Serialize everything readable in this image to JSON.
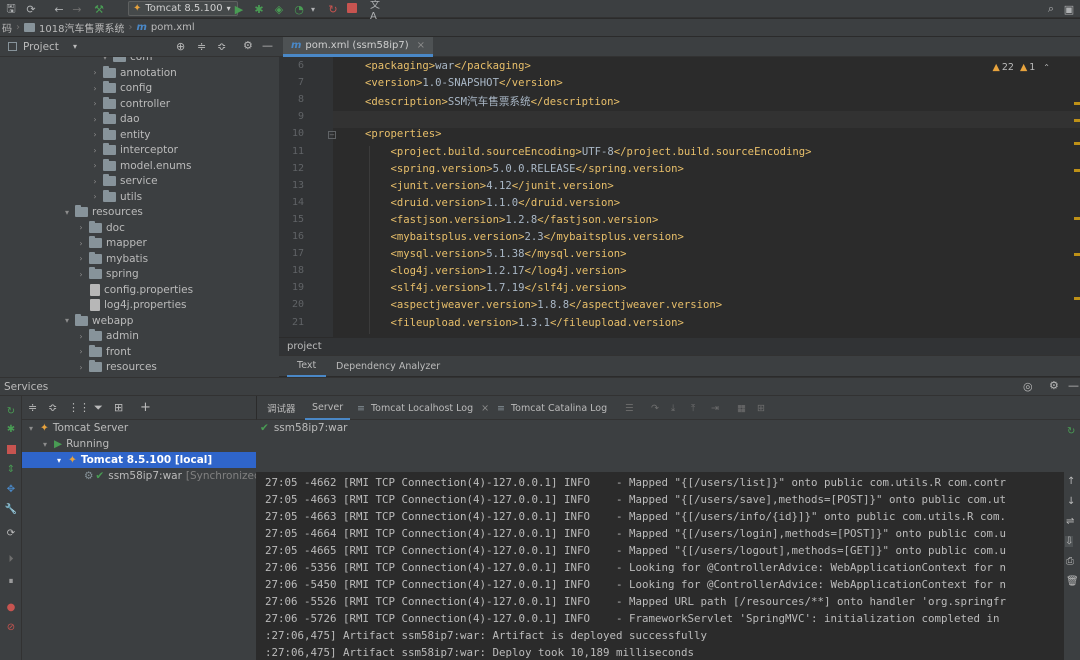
{
  "toolbar": {
    "run_config": "Tomcat 8.5.100",
    "translate_icon": "文A"
  },
  "breadcrumb": {
    "project": "码",
    "module": "1018汽车售票系统",
    "file_glyph": "m",
    "file": "pom.xml"
  },
  "project_panel": {
    "title": "Project",
    "items": [
      {
        "label": "com",
        "kind": "folder",
        "expanded": true
      },
      {
        "label": "annotation",
        "kind": "folder"
      },
      {
        "label": "config",
        "kind": "folder"
      },
      {
        "label": "controller",
        "kind": "folder"
      },
      {
        "label": "dao",
        "kind": "folder"
      },
      {
        "label": "entity",
        "kind": "folder"
      },
      {
        "label": "interceptor",
        "kind": "folder"
      },
      {
        "label": "model.enums",
        "kind": "folder"
      },
      {
        "label": "service",
        "kind": "folder"
      },
      {
        "label": "utils",
        "kind": "folder"
      },
      {
        "label": "resources",
        "kind": "folder",
        "expanded": true
      },
      {
        "label": "doc",
        "kind": "folder"
      },
      {
        "label": "mapper",
        "kind": "folder"
      },
      {
        "label": "mybatis",
        "kind": "folder"
      },
      {
        "label": "spring",
        "kind": "folder"
      },
      {
        "label": "config.properties",
        "kind": "file"
      },
      {
        "label": "log4j.properties",
        "kind": "file"
      },
      {
        "label": "webapp",
        "kind": "folder",
        "expanded": true
      },
      {
        "label": "admin",
        "kind": "folder"
      },
      {
        "label": "front",
        "kind": "folder"
      },
      {
        "label": "resources",
        "kind": "folder"
      }
    ]
  },
  "editor": {
    "tab_glyph": "m",
    "tab_label": "pom.xml (ssm58ip7)",
    "tab_close": "×",
    "warnings": "22",
    "weak_warnings": "1",
    "lines": [
      {
        "no": "6",
        "code": "<packaging>war</packaging>"
      },
      {
        "no": "7",
        "code": "<version>1.0-SNAPSHOT</version>"
      },
      {
        "no": "8",
        "code": "<description>SSM汽车售票系统</description>"
      },
      {
        "no": "9",
        "code": ""
      },
      {
        "no": "10",
        "code": "<properties>"
      },
      {
        "no": "11",
        "code": "    <project.build.sourceEncoding>UTF-8</project.build.sourceEncoding>"
      },
      {
        "no": "12",
        "code": "    <spring.version>5.0.0.RELEASE</spring.version>"
      },
      {
        "no": "13",
        "code": "    <junit.version>4.12</junit.version>"
      },
      {
        "no": "14",
        "code": "    <druid.version>1.1.0</druid.version>"
      },
      {
        "no": "15",
        "code": "    <fastjson.version>1.2.8</fastjson.version>"
      },
      {
        "no": "16",
        "code": "    <mybaitsplus.version>2.3</mybaitsplus.version>"
      },
      {
        "no": "17",
        "code": "    <mysql.version>5.1.38</mysql.version>"
      },
      {
        "no": "18",
        "code": "    <log4j.version>1.2.17</log4j.version>"
      },
      {
        "no": "19",
        "code": "    <slf4j.version>1.7.19</slf4j.version>"
      },
      {
        "no": "20",
        "code": "    <aspectjweaver.version>1.8.8</aspectjweaver.version>"
      },
      {
        "no": "21",
        "code": "    <fileupload.version>1.3.1</fileupload.version>"
      }
    ],
    "footer_breadcrumb": "project",
    "bottom_tabs": [
      "Text",
      "Dependency Analyzer"
    ]
  },
  "services": {
    "title": "Services",
    "tree": {
      "server": "Tomcat Server",
      "status": "Running",
      "instance": "Tomcat 8.5.100 [local]",
      "artifact": "ssm58ip7:war",
      "artifact_state": "[Synchronized]"
    },
    "tabs": [
      "调试器",
      "Server",
      "Tomcat Localhost Log",
      "Tomcat Catalina Log"
    ],
    "deployment": "ssm58ip7:war",
    "log_lines": [
      "27:05 -4662 [RMI TCP Connection(4)-127.0.0.1] INFO    - Mapped \"{[/users/list]}\" onto public com.utils.R com.contr",
      "27:05 -4663 [RMI TCP Connection(4)-127.0.0.1] INFO    - Mapped \"{[/users/save],methods=[POST]}\" onto public com.ut",
      "27:05 -4663 [RMI TCP Connection(4)-127.0.0.1] INFO    - Mapped \"{[/users/info/{id}]}\" onto public com.utils.R com.",
      "27:05 -4664 [RMI TCP Connection(4)-127.0.0.1] INFO    - Mapped \"{[/users/login],methods=[POST]}\" onto public com.u",
      "27:05 -4665 [RMI TCP Connection(4)-127.0.0.1] INFO    - Mapped \"{[/users/logout],methods=[GET]}\" onto public com.u",
      "27:06 -5356 [RMI TCP Connection(4)-127.0.0.1] INFO    - Looking for @ControllerAdvice: WebApplicationContext for n",
      "27:06 -5450 [RMI TCP Connection(4)-127.0.0.1] INFO    - Looking for @ControllerAdvice: WebApplicationContext for n",
      "27:06 -5526 [RMI TCP Connection(4)-127.0.0.1] INFO    - Mapped URL path [/resources/**] onto handler 'org.springfr",
      "27:06 -5726 [RMI TCP Connection(4)-127.0.0.1] INFO    - FrameworkServlet 'SpringMVC': initialization completed in",
      ":27:06,475] Artifact ssm58ip7:war: Artifact is deployed successfully",
      ":27:06,475] Artifact ssm58ip7:war: Deploy took 10,189 milliseconds"
    ]
  },
  "colors": {
    "tag": "#e8bf6a",
    "text": "#a9b7c6",
    "selection": "#2f65ca",
    "run_green": "#499c54",
    "stop_red": "#c75450"
  }
}
